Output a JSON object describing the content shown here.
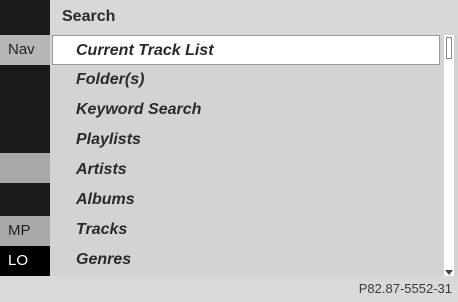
{
  "background_menu": {
    "items": [
      "Nav",
      "MP",
      "LO"
    ]
  },
  "search": {
    "title": "Search",
    "items": [
      {
        "label": "Current Track List",
        "selected": true
      },
      {
        "label": "Folder(s)"
      },
      {
        "label": "Keyword Search"
      },
      {
        "label": "Playlists"
      },
      {
        "label": "Artists"
      },
      {
        "label": "Albums"
      },
      {
        "label": "Tracks"
      },
      {
        "label": "Genres"
      }
    ]
  },
  "caption": "P82.87-5552-31",
  "icons": {
    "scroll_down": "triangle-down-icon"
  }
}
